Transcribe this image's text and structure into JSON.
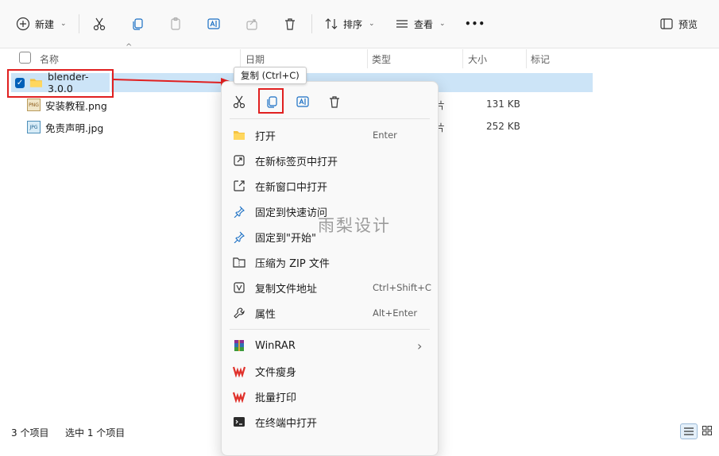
{
  "toolbar": {
    "new_label": "新建",
    "sort_label": "排序",
    "view_label": "查看",
    "more_label": "•••",
    "preview_label": "预览"
  },
  "columns": {
    "name": "名称",
    "date": "日期",
    "type": "类型",
    "size": "大小",
    "tags": "标记"
  },
  "files": [
    {
      "name": "blender-3.0.0",
      "kind": "folder",
      "selected": true
    },
    {
      "name": "安装教程.png",
      "kind": "png",
      "size": "131 KB",
      "type_partial": "片"
    },
    {
      "name": "免责声明.jpg",
      "kind": "jpg",
      "size": "252 KB",
      "type_partial": "片"
    }
  ],
  "tooltip": "复制 (Ctrl+C)",
  "menu": {
    "items": [
      {
        "label": "打开",
        "shortcut": "Enter",
        "icon": "folder-open-icon"
      },
      {
        "label": "在新标签页中打开",
        "shortcut": "",
        "icon": "new-tab-icon"
      },
      {
        "label": "在新窗口中打开",
        "shortcut": "",
        "icon": "new-window-icon"
      },
      {
        "label": "固定到快速访问",
        "shortcut": "",
        "icon": "pin-icon"
      },
      {
        "label": "固定到\"开始\"",
        "shortcut": "",
        "icon": "pin-start-icon"
      },
      {
        "label": "压缩为 ZIP 文件",
        "shortcut": "",
        "icon": "zip-icon"
      },
      {
        "label": "复制文件地址",
        "shortcut": "Ctrl+Shift+C",
        "icon": "copy-path-icon"
      },
      {
        "label": "属性",
        "shortcut": "Alt+Enter",
        "icon": "wrench-icon"
      }
    ],
    "items2": [
      {
        "label": "WinRAR",
        "icon": "winrar-icon",
        "chevron": "›"
      },
      {
        "label": "文件瘦身",
        "icon": "wps-icon"
      },
      {
        "label": "批量打印",
        "icon": "wps-print-icon"
      },
      {
        "label": "在终端中打开",
        "icon": "terminal-icon"
      }
    ]
  },
  "watermark": "雨梨设计",
  "status": {
    "count": "3 个项目",
    "selected": "选中 1 个项目"
  },
  "colors": {
    "accent": "#005fb8",
    "highlight_red": "#e02020",
    "selection": "#cce4f7"
  }
}
